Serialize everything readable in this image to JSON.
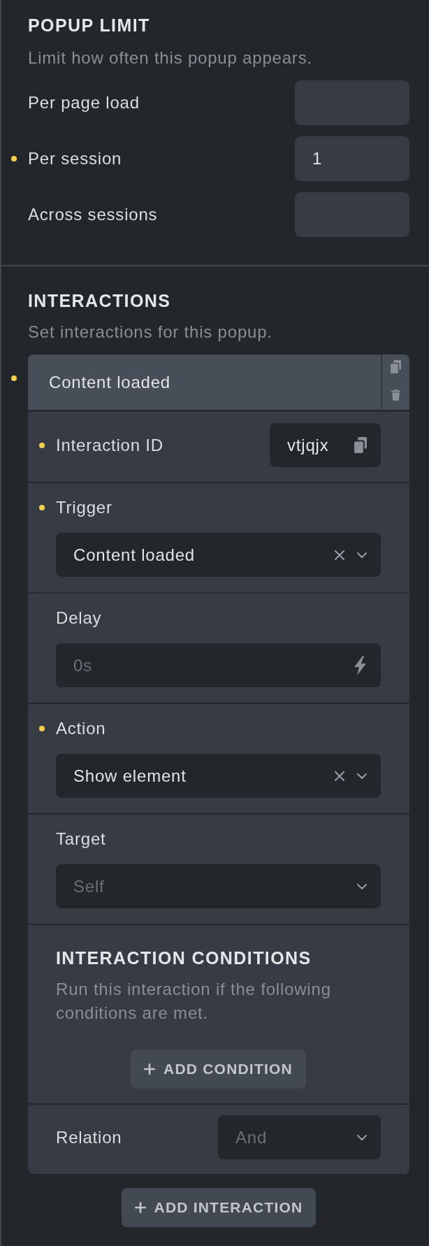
{
  "popup_limit": {
    "title": "POPUP LIMIT",
    "description": "Limit how often this popup appears.",
    "fields": [
      {
        "label": "Per page load",
        "modified": false
      },
      {
        "label": "Per session",
        "modified": true,
        "value": "1"
      },
      {
        "label": "Across sessions",
        "modified": false
      }
    ]
  },
  "interactions": {
    "title": "INTERACTIONS",
    "description": "Set interactions for this popup.",
    "items": [
      {
        "title": "Content loaded",
        "modified": true,
        "controls": [
          {
            "kind": "id",
            "label": "Interaction ID",
            "modified": true,
            "value": "vtjqjx"
          },
          {
            "kind": "select",
            "label": "Trigger",
            "modified": true,
            "value": "Content loaded"
          },
          {
            "kind": "text",
            "label": "Delay",
            "modified": false,
            "placeholder": "0s"
          },
          {
            "kind": "select",
            "label": "Action",
            "modified": true,
            "value": "Show element"
          },
          {
            "kind": "select",
            "label": "Target",
            "modified": false,
            "placeholder": "Self"
          },
          {
            "kind": "conditions",
            "title": "INTERACTION CONDITIONS",
            "description": "Run this interaction if the following conditions are met.",
            "button": "ADD CONDITION"
          },
          {
            "kind": "inline_select",
            "label": "Relation",
            "modified": false,
            "placeholder": "And"
          }
        ]
      }
    ],
    "add_button": "ADD INTERACTION"
  }
}
